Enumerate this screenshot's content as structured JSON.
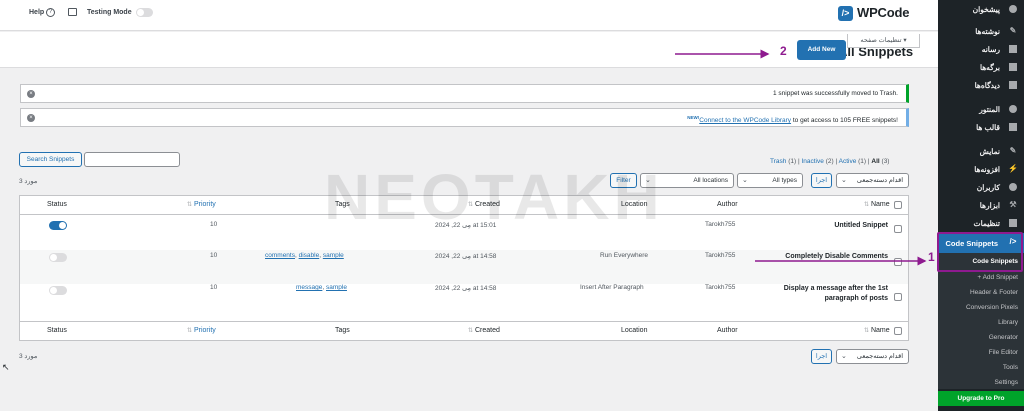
{
  "header": {
    "brand": "WPCode",
    "brand_mark": "/>",
    "help_label": "Help",
    "help_icon": "?",
    "testing_mode_label": "Testing Mode"
  },
  "title_row": {
    "page_title": "All Snippets",
    "add_new_label": "Add New",
    "screen_options_label": "تنظیمات صفحه ▾"
  },
  "notices": {
    "success_text": "1 snippet was successfully moved to Trash.",
    "info_prefix": "Connect to the WPCode Library",
    "info_badge": "NEW!",
    "info_suffix": " to get access to 105 FREE snippets!",
    "dismiss_glyph": "×"
  },
  "search": {
    "button_label": "Search Snippets"
  },
  "views": {
    "all": "All",
    "all_count": "(3)",
    "active": "Active",
    "active_count": "(1)",
    "inactive": "Inactive",
    "inactive_count": "(2)",
    "trash": "Trash",
    "trash_count": "(1)",
    "separator": "|"
  },
  "bulk": {
    "select_label": "اقدام دسته‌جمعی",
    "apply_label": "اجرا",
    "items_count": "3 مورد"
  },
  "filters": {
    "types_label": "All types",
    "locations_label": "All locations",
    "filter_label": "Filter"
  },
  "table": {
    "columns": {
      "name": "Name",
      "author": "Author",
      "location": "Location",
      "created": "Created",
      "tags": "Tags",
      "priority": "Priority",
      "status": "Status",
      "sort_glyph": "⇅"
    },
    "rows": [
      {
        "name": "Untitled Snippet",
        "author": "Tarokh755",
        "location": "",
        "created": "مِی 22, 2024 at 15:01",
        "tags": [],
        "priority": "10",
        "active": true
      },
      {
        "name": "Completely Disable Comments",
        "author": "Tarokh755",
        "location": "Run Everywhere",
        "created": "مِی 22, 2024 at 14:58",
        "tags": [
          "comments",
          "disable",
          "sample"
        ],
        "priority": "10",
        "active": false
      },
      {
        "name": "Display a message after the 1st paragraph of posts",
        "author": "Tarokh755",
        "location": "Insert After Paragraph",
        "created": "مِی 22, 2024 at 14:58",
        "tags": [
          "message",
          "sample"
        ],
        "priority": "10",
        "active": false
      }
    ]
  },
  "sidebar": {
    "items": [
      {
        "label": "پیشخوان",
        "icon": "dashboard-icon"
      },
      {
        "label": "نوشته‌ها",
        "icon": "pin-icon"
      },
      {
        "label": "رسانه",
        "icon": "media-icon"
      },
      {
        "label": "برگه‌ها",
        "icon": "page-icon"
      },
      {
        "label": "دیدگاه‌ها",
        "icon": "comment-icon"
      },
      {
        "label": "المنتور",
        "icon": "elementor-icon"
      },
      {
        "label": "قالب ها",
        "icon": "template-icon"
      },
      {
        "label": "نمایش",
        "icon": "brush-icon"
      },
      {
        "label": "افزونه‌ها",
        "icon": "plugin-icon"
      },
      {
        "label": "کاربران",
        "icon": "users-icon"
      },
      {
        "label": "ابزارها",
        "icon": "wrench-icon"
      },
      {
        "label": "تنظیمات",
        "icon": "settings-icon"
      }
    ],
    "code_snippets": "Code Snippets",
    "submenu": [
      {
        "label": "Code Snippets",
        "current": true
      },
      {
        "label": "+ Add Snippet"
      },
      {
        "label": "Header & Footer"
      },
      {
        "label": "Conversion Pixels"
      },
      {
        "label": "Library"
      },
      {
        "label": "Generator"
      },
      {
        "label": "File Editor"
      },
      {
        "label": "Tools"
      },
      {
        "label": "Settings"
      }
    ],
    "upgrade_label": "Upgrade to Pro"
  },
  "annotations": {
    "marker_1": "1",
    "marker_2": "2",
    "color": "#8e1a8f"
  },
  "watermark": "NEOTAKH"
}
